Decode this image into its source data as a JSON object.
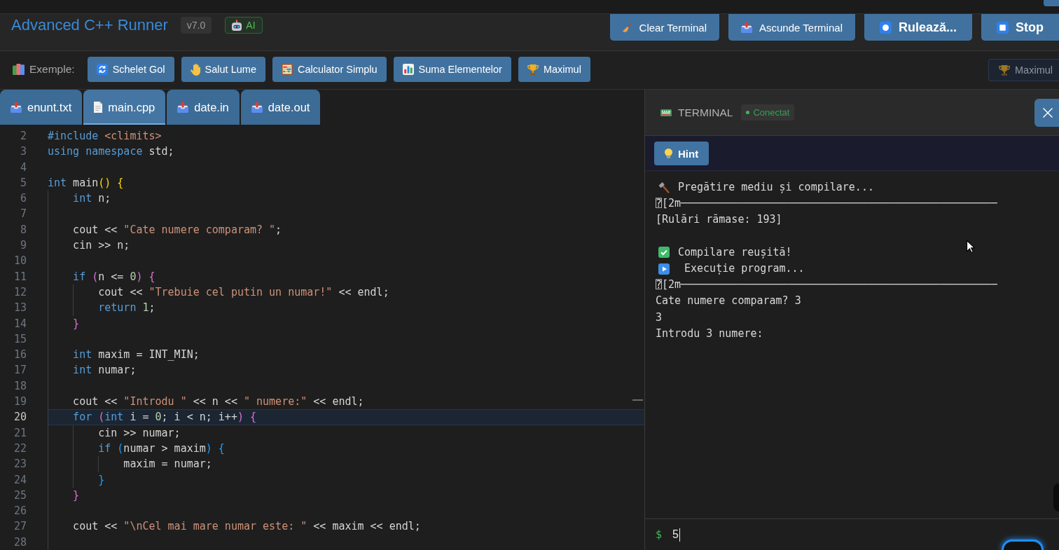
{
  "header": {
    "title": "Advanced C++ Runner",
    "version": "v7.0",
    "ai_badge": "AI",
    "buttons": [
      {
        "label": "Clear Terminal",
        "kind": "secondary"
      },
      {
        "label": "Ascunde Terminal",
        "kind": "secondary"
      },
      {
        "label": "Rulează...",
        "kind": "primary"
      },
      {
        "label": "Stop",
        "kind": "primary"
      }
    ]
  },
  "examples": {
    "label": "Exemple:",
    "buttons": [
      "Schelet Gol",
      "Salut Lume",
      "Calculator Simplu",
      "Suma Elementelor",
      "Maximul"
    ],
    "faded_button": "Maximul"
  },
  "tabs": [
    {
      "label": "enunt.txt",
      "selected": false
    },
    {
      "label": "main.cpp",
      "selected": true
    },
    {
      "label": "date.in",
      "selected": false
    },
    {
      "label": "date.out",
      "selected": false
    }
  ],
  "editor": {
    "lines": [
      {
        "number": "2",
        "active": false,
        "tokens": [
          {
            "text": "#include",
            "kind": "keyword"
          },
          {
            "text": " <climits>",
            "kind": "string"
          }
        ]
      },
      {
        "number": "3",
        "active": false,
        "tokens": [
          {
            "text": "using namespace",
            "kind": "keyword"
          },
          {
            "text": " std;",
            "kind": "plain"
          }
        ]
      },
      {
        "number": "4",
        "active": false
      },
      {
        "number": "5",
        "active": false,
        "tokens": [
          {
            "text": "int",
            "kind": "keyword"
          },
          {
            "text": " main",
            "kind": "plain"
          },
          {
            "text": "()",
            "kind": "bracket1"
          },
          {
            "text": " {",
            "kind": "bracket1"
          }
        ]
      },
      {
        "number": "6",
        "active": false,
        "tokens": [
          {
            "text": "    int",
            "kind": "keyword"
          },
          {
            "text": " n;",
            "kind": "plain"
          }
        ]
      },
      {
        "number": "7",
        "active": false
      },
      {
        "number": "8",
        "active": false,
        "tokens": [
          {
            "text": "    cout << ",
            "kind": "plain"
          },
          {
            "text": "\"Cate numere comparam? \"",
            "kind": "string"
          },
          {
            "text": ";",
            "kind": "plain"
          }
        ]
      },
      {
        "number": "9",
        "active": false,
        "tokens": [
          {
            "text": "    cin >> n;",
            "kind": "plain"
          }
        ]
      },
      {
        "number": "10",
        "active": false
      },
      {
        "number": "11",
        "active": false,
        "tokens": [
          {
            "text": "    if",
            "kind": "keyword"
          },
          {
            "text": " (",
            "kind": "bracket2"
          },
          {
            "text": "n <= ",
            "kind": "plain"
          },
          {
            "text": "0",
            "kind": "number"
          },
          {
            "text": ")",
            "kind": "bracket2"
          },
          {
            "text": " {",
            "kind": "bracket2"
          }
        ]
      },
      {
        "number": "12",
        "active": false,
        "tokens": [
          {
            "text": "        cout << ",
            "kind": "plain"
          },
          {
            "text": "\"Trebuie cel putin un numar!\"",
            "kind": "string"
          },
          {
            "text": " << endl;",
            "kind": "plain"
          }
        ]
      },
      {
        "number": "13",
        "active": false,
        "tokens": [
          {
            "text": "        return",
            "kind": "keyword"
          },
          {
            "text": " 1",
            "kind": "number"
          },
          {
            "text": ";",
            "kind": "plain"
          }
        ]
      },
      {
        "number": "14",
        "active": false,
        "tokens": [
          {
            "text": "    }",
            "kind": "bracket2"
          }
        ]
      },
      {
        "number": "15",
        "active": false
      },
      {
        "number": "16",
        "active": false,
        "tokens": [
          {
            "text": "    int",
            "kind": "keyword"
          },
          {
            "text": " maxim = INT_MIN;",
            "kind": "plain"
          }
        ]
      },
      {
        "number": "17",
        "active": false,
        "tokens": [
          {
            "text": "    int",
            "kind": "keyword"
          },
          {
            "text": " numar;",
            "kind": "plain"
          }
        ]
      },
      {
        "number": "18",
        "active": false
      },
      {
        "number": "19",
        "active": false,
        "tokens": [
          {
            "text": "    cout << ",
            "kind": "plain"
          },
          {
            "text": "\"Introdu \"",
            "kind": "string"
          },
          {
            "text": " << n << ",
            "kind": "plain"
          },
          {
            "text": "\" numere:\"",
            "kind": "string"
          },
          {
            "text": " << endl;",
            "kind": "plain"
          }
        ]
      },
      {
        "number": "20",
        "active": true,
        "tokens": [
          {
            "text": "    for",
            "kind": "keyword"
          },
          {
            "text": " (",
            "kind": "bracket2"
          },
          {
            "text": "int",
            "kind": "keyword"
          },
          {
            "text": " i = ",
            "kind": "plain"
          },
          {
            "text": "0",
            "kind": "number"
          },
          {
            "text": "; i < n; i++",
            "kind": "plain"
          },
          {
            "text": ")",
            "kind": "bracket2"
          },
          {
            "text": " {",
            "kind": "bracket2"
          }
        ]
      },
      {
        "number": "21",
        "active": false,
        "tokens": [
          {
            "text": "        cin >> numar;",
            "kind": "plain"
          }
        ]
      },
      {
        "number": "22",
        "active": false,
        "tokens": [
          {
            "text": "        if",
            "kind": "keyword"
          },
          {
            "text": " (",
            "kind": "bracket3"
          },
          {
            "text": "numar > maxim",
            "kind": "plain"
          },
          {
            "text": ")",
            "kind": "bracket3"
          },
          {
            "text": " {",
            "kind": "bracket3"
          }
        ]
      },
      {
        "number": "23",
        "active": false,
        "tokens": [
          {
            "text": "            maxim = numar;",
            "kind": "plain"
          }
        ]
      },
      {
        "number": "24",
        "active": false,
        "tokens": [
          {
            "text": "        }",
            "kind": "bracket3"
          }
        ]
      },
      {
        "number": "25",
        "active": false,
        "tokens": [
          {
            "text": "    }",
            "kind": "bracket2"
          }
        ]
      },
      {
        "number": "26",
        "active": false
      },
      {
        "number": "27",
        "active": false,
        "tokens": [
          {
            "text": "    cout << ",
            "kind": "plain"
          },
          {
            "text": "\"\\nCel mai mare numar este: \"",
            "kind": "string"
          },
          {
            "text": " << maxim << endl;",
            "kind": "plain"
          }
        ]
      },
      {
        "number": "28",
        "active": false
      }
    ]
  },
  "terminal": {
    "title": "TERMINAL",
    "status": {
      "label": "Conectat",
      "connected": true
    },
    "hint_button": "Hint",
    "lines": [
      {
        "kind": "build",
        "text": "Pregătire mediu și compilare..."
      },
      {
        "kind": "plain",
        "text": "⍰[2m──────────────────────────────────────────────────"
      },
      {
        "kind": "plain",
        "text": "[Rulări rămase: 193]"
      },
      {
        "kind": "gap"
      },
      {
        "kind": "success",
        "text": "Compilare reușită!"
      },
      {
        "kind": "exec",
        "text": "Execuție program..."
      },
      {
        "kind": "plain",
        "text": "⍰[2m──────────────────────────────────────────────────"
      },
      {
        "kind": "plain",
        "text": "Cate numere comparam? 3"
      },
      {
        "kind": "plain",
        "text": "3"
      },
      {
        "kind": "plain",
        "text": "Introdu 3 numere:"
      }
    ],
    "prompt": "$",
    "input": {
      "value": "5"
    }
  }
}
